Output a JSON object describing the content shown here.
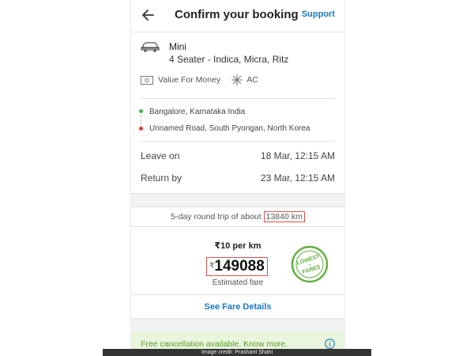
{
  "header": {
    "title": "Confirm your booking",
    "support_label": "Support"
  },
  "cab": {
    "icon": "car-icon",
    "name": "Mini",
    "models": "4 Seater - Indica, Micra, Ritz",
    "features": [
      {
        "icon": "money-icon",
        "label": "Value For Money"
      },
      {
        "icon": "snowflake-icon",
        "label": "AC"
      }
    ]
  },
  "route": {
    "pickup": "Bangalore, Karnataka India",
    "drop": "Unnamed Road, South Pyongan, North Korea",
    "pickup_color": "#4caf50",
    "drop_color": "#e53935"
  },
  "schedule": {
    "leave_label": "Leave on",
    "leave_value": "18 Mar, 12:15 AM",
    "return_label": "Return by",
    "return_value": "23 Mar, 12:15 AM"
  },
  "trip": {
    "prefix": "5-day round trip of about",
    "distance": "13840 km"
  },
  "fare": {
    "per_km": "₹10 per km",
    "currency": "₹",
    "amount": "149088",
    "caption": "Estimated fare",
    "stamp_top": "LOWEST",
    "stamp_mid": "in",
    "stamp_bottom": "FARES",
    "details_link": "See Fare Details"
  },
  "cancellation": {
    "text": "Free cancellation available. Know more.",
    "icon": "info-icon"
  },
  "credit": "Image credit: Prashant Shahi",
  "colors": {
    "accent": "#1a78c2",
    "highlight_box": "#d9534f",
    "cancel_bg": "#e9f5dd",
    "cancel_text": "#5c9a2c"
  }
}
